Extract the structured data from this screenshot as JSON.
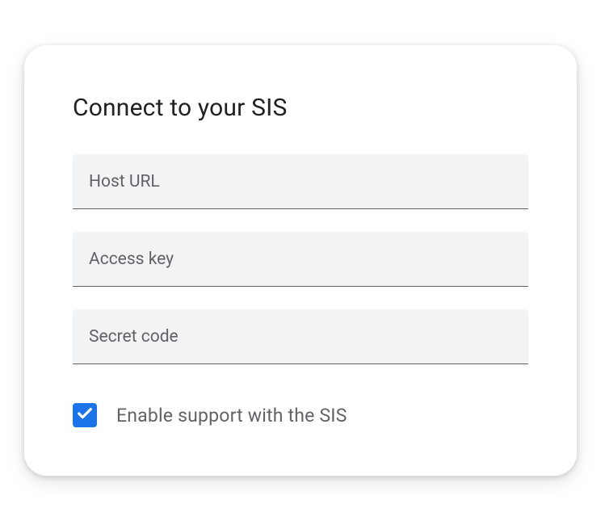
{
  "title": "Connect to your SIS",
  "fields": {
    "host_url": {
      "placeholder": "Host URL",
      "value": ""
    },
    "access_key": {
      "placeholder": "Access key",
      "value": ""
    },
    "secret_code": {
      "placeholder": "Secret code",
      "value": ""
    }
  },
  "checkbox": {
    "label": "Enable support with the SIS",
    "checked": true
  }
}
